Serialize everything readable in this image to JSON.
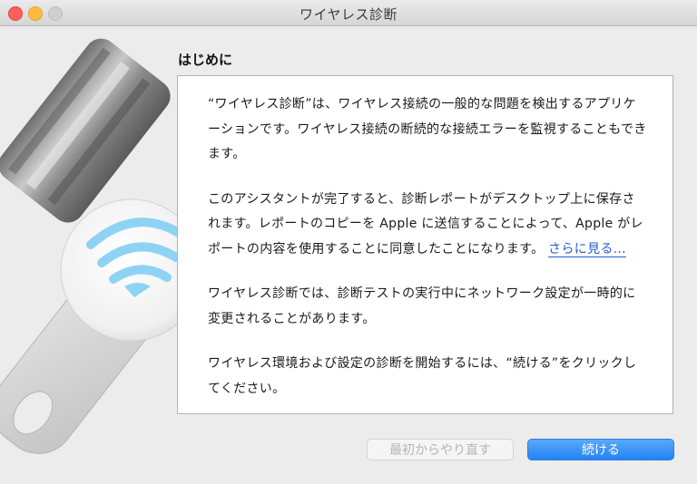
{
  "window": {
    "title": "ワイヤレス診断"
  },
  "section": {
    "heading": "はじめに"
  },
  "content": {
    "paragraphs": [
      "“ワイヤレス診断”は、ワイヤレス接続の一般的な問題を検出するアプリケーションです。ワイヤレス接続の断続的な接続エラーを監視することもできます。",
      "このアシスタントが完了すると、診断レポートがデスクトップ上に保存されます。レポートのコピーを Apple に送信することによって、Apple がレポートの内容を使用することに同意したことになります。",
      "ワイヤレス診断では、診断テストの実行中にネットワーク設定が一時的に変更されることがあります。",
      "ワイヤレス環境および設定の診断を開始するには、“続ける”をクリックしてください。"
    ],
    "more_link": "さらに見る..."
  },
  "buttons": {
    "restart": "最初からやり直す",
    "continue": "続ける"
  },
  "colors": {
    "accent": "#2383f5",
    "link": "#1f5fd0",
    "wifi": "#8fd3f4"
  },
  "icons": {
    "app": "wireless-diagnostics-icon"
  }
}
